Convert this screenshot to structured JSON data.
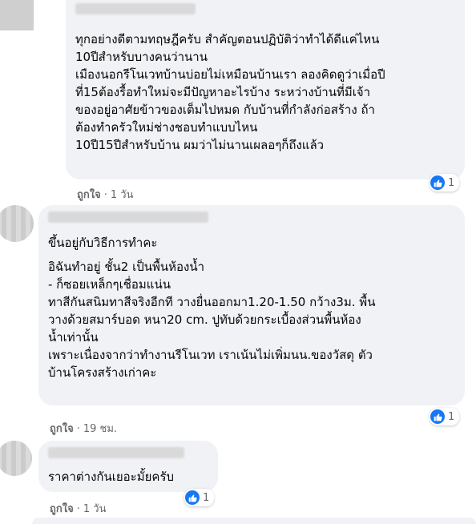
{
  "comments": [
    {
      "lines": [
        "ทุกอย่างดีตามทฤษฎีครับ สำคัญตอนปฏิบัติว่าทำได้ดีแค่ไหน",
        "10ปีสำหรับบางคนว่านาน",
        "เมืองนอกรีโนเวทบ้านบ่อยไม่เหมือนบ้านเรา ลองคิดดูว่าเมื่อปี",
        "ที่15ต้องรื้อทำใหม่จะมีปัญหาอะไรบ้าง ระหว่างบ้านที่มีเจ้า",
        "ของอยู่อาศัยข้าวของเต็มไปหมด กับบ้านที่กำลังก่อสร้าง ถ้า",
        "ต้องทำครัวใหม่ช่างชอบทำแบบไหน",
        "10ปี15ปีสำหรับบ้าน ผมว่าไม่นานเผลอๆก็ถึงแล้ว"
      ],
      "like_label": "ถูกใจ",
      "separator": "·",
      "time": "1 วัน",
      "reaction_count": "1"
    },
    {
      "lines": [
        "ขึ้นอยู่กับวิธีการทำคะ",
        "อิฉันทำอยู่ ชั้น2 เป็นพื้นห้องน้ำ",
        "- ก็ซอยเหล็กๆเชื่อมแน่น",
        "ทาสีกันสนิมทาสีจริงอีกที วางยื่นออกมา1.20-1.50 กว้าง3ม. พื้น",
        "วางด้วยสมาร์บอด หนา20 cm. ปูทับด้วยกระเบื้องส่วนพื้นห้อง",
        "น้ำเท่านั้น",
        "เพราะเนื่องจากว่าทำงานรีโนเวท เราเน้นไม่เพิ่มนน.ของวัสดุ ตัว",
        "บ้านโครงสร้างเก่าคะ"
      ],
      "like_label": "ถูกใจ",
      "separator": "·",
      "time": "19 ชม.",
      "reaction_count": "1"
    },
    {
      "lines": [
        "ราคาต่างกันเยอะมั้ยครับ"
      ],
      "like_label": "ถูกใจ",
      "separator": "·",
      "time": "1 วัน",
      "reaction_count": "1"
    }
  ],
  "colors": {
    "bubble": "#f0f2f5",
    "meta_text": "#65676b",
    "like_blue": "#1877f2"
  },
  "icons": {
    "reaction": "thumbs-up-icon"
  }
}
